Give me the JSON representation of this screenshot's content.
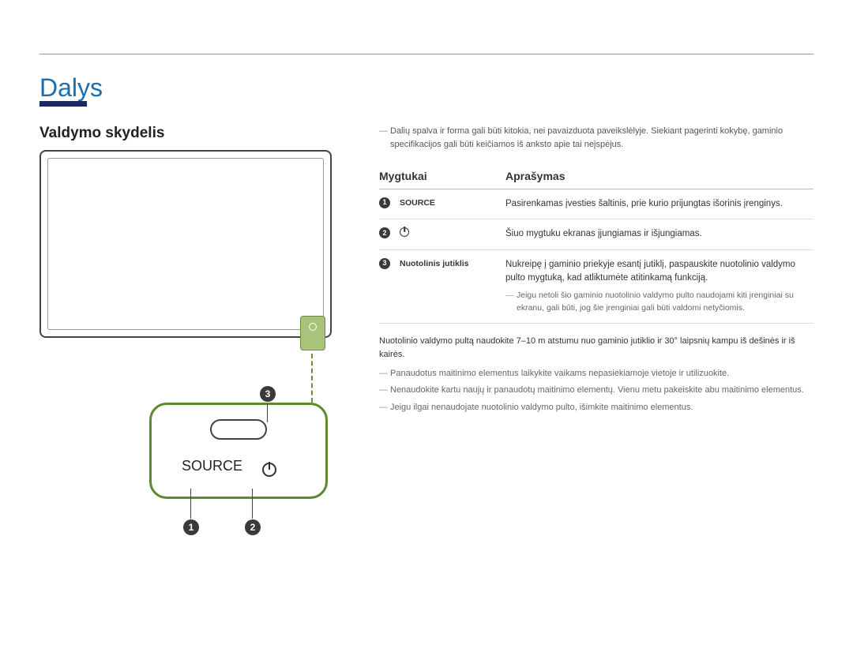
{
  "title": "Dalys",
  "section": "Valdymo skydelis",
  "diagram": {
    "source_label": "SOURCE",
    "callouts": {
      "one": "1",
      "two": "2",
      "three": "3"
    }
  },
  "top_note": "Dalių spalva ir forma gali būti kitokia, nei pavaizduota paveikslėlyje. Siekiant pagerinti kokybę, gaminio specifikacijos gali būti keičiamos iš anksto apie tai neįspėjus.",
  "table": {
    "headers": {
      "buttons": "Mygtukai",
      "description": "Aprašymas"
    },
    "rows": [
      {
        "num": "1",
        "label": "SOURCE",
        "icon": "text",
        "desc": "Pasirenkamas įvesties šaltinis, prie kurio prijungtas išorinis įrenginys."
      },
      {
        "num": "2",
        "label": "",
        "icon": "power",
        "desc": "Šiuo mygtuku ekranas įjungiamas ir išjungiamas."
      },
      {
        "num": "3",
        "label": "Nuotolinis jutiklis",
        "icon": "text",
        "desc": "Nukreipę į gaminio priekyje esantį jutiklį, paspauskite nuotolinio valdymo pulto mygtuką, kad atliktumėte atitinkamą funkciją.",
        "subnote": "Jeigu netoli šio gaminio nuotolinio valdymo pulto naudojami kiti įrenginiai su ekranu, gali būti, jog šie įrenginiai gali būti valdomi netyčiomis."
      }
    ]
  },
  "footnotes": {
    "lead": "Nuotolinio valdymo pultą naudokite 7–10 m atstumu nuo gaminio jutiklio ir 30° laipsnių kampu iš dešinės ir iš kairės.",
    "items": [
      "Panaudotus maitinimo elementus laikykite vaikams nepasiekiamoje vietoje ir utilizuokite.",
      "Nenaudokite kartu naujų ir panaudotų maitinimo elementų. Vienu metu pakeiskite abu maitinimo elementus.",
      "Jeigu ilgai nenaudojate nuotolinio valdymo pulto, išimkite maitinimo elementus."
    ]
  }
}
